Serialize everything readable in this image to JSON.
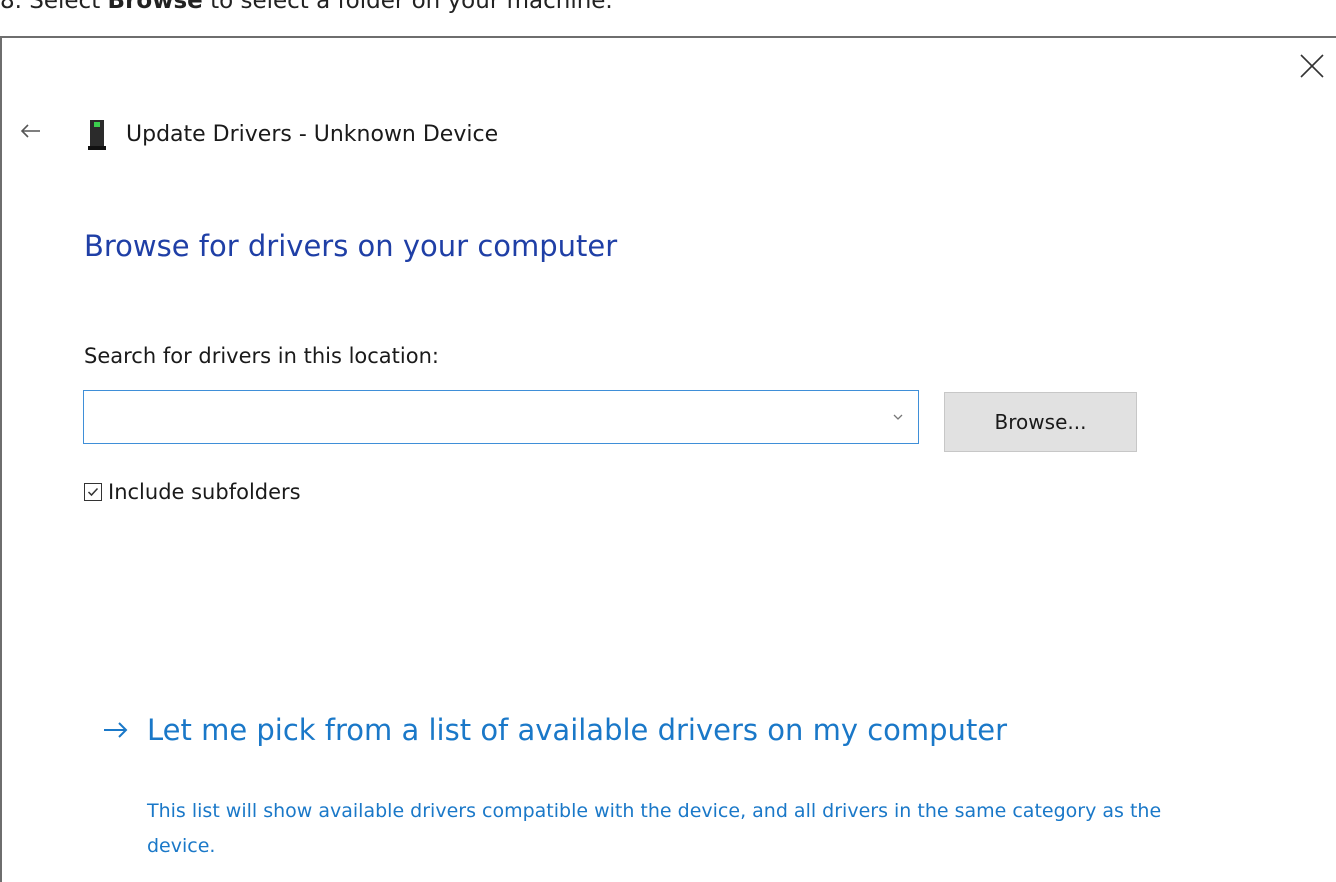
{
  "instruction": {
    "number": "8.",
    "prefix": "Select",
    "bold": "Browse",
    "suffix": "to select a folder on your machine."
  },
  "window": {
    "title": "Update Drivers - Unknown Device",
    "heading": "Browse for drivers on your computer",
    "search_label": "Search for drivers in this location:",
    "path_value": "",
    "browse_label": "Browse...",
    "include_subfolders_label": "Include subfolders",
    "include_subfolders_checked": true,
    "pick_title": "Let me pick from a list of available drivers on my computer",
    "pick_description": "This list will show available drivers compatible with the device, and all drivers in the same category as the device."
  },
  "icons": {
    "close": "close-icon",
    "back": "back-arrow-icon",
    "device": "device-icon",
    "chevron": "chevron-down-icon",
    "checkmark": "checkmark-icon",
    "link_arrow": "arrow-right-icon"
  },
  "colors": {
    "heading": "#1f3fa6",
    "link": "#1a78c8",
    "input_border": "#3f8fd8",
    "button_bg": "#e1e1e1"
  }
}
